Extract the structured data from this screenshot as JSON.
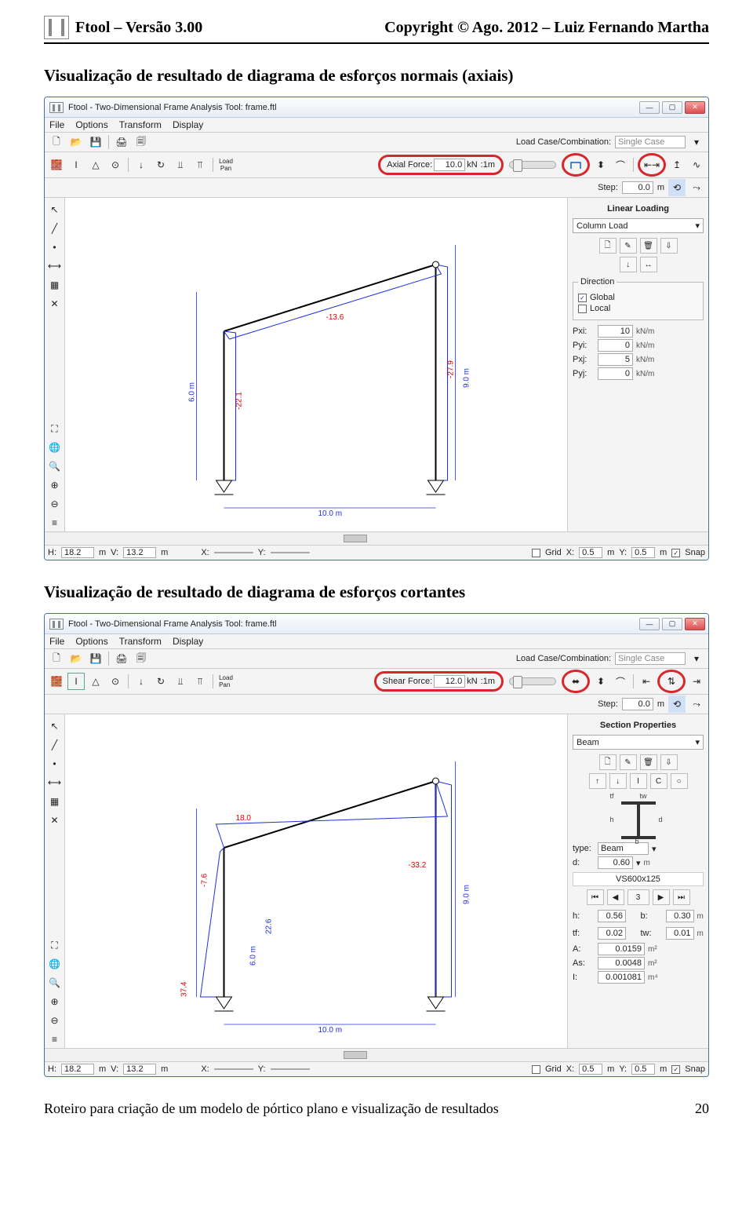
{
  "doc": {
    "header_left": "Ftool – Versão 3.00",
    "header_right": "Copyright © Ago. 2012 – Luiz Fernando Martha",
    "sec1": "Visualização de resultado de diagrama de esforços normais (axiais)",
    "sec2": "Visualização de resultado de diagrama de esforços cortantes",
    "footer_left": "Roteiro para criação de um modelo de pórtico plano e visualização de resultados",
    "footer_right": "20"
  },
  "app": {
    "title": "Ftool - Two-Dimensional Frame Analysis Tool: frame.ftl",
    "menu": [
      "File",
      "Options",
      "Transform",
      "Display"
    ],
    "load_combo_label": "Load Case/Combination:",
    "load_combo_value": "Single Case",
    "step_label": "Step:",
    "step_value": "0.0",
    "step_unit": "m",
    "load_lbl": "Load\nPan"
  },
  "win1": {
    "force_label": "Axial Force:",
    "force_value": "10.0",
    "force_unit": "kN",
    "force_unit2": ":1m",
    "panel_title": "Linear Loading",
    "panel_drop": "Column Load",
    "direction_title": "Direction",
    "dir_global": "Global",
    "dir_local": "Local",
    "params": [
      {
        "l": "Pxi:",
        "v": "10",
        "u": "kN/m"
      },
      {
        "l": "Pyi:",
        "v": "0",
        "u": "kN/m"
      },
      {
        "l": "Pxj:",
        "v": "5",
        "u": "kN/m"
      },
      {
        "l": "Pyj:",
        "v": "0",
        "u": "kN/m"
      }
    ],
    "canvas_labels": {
      "top_dia": "-13.6",
      "left_col": "-22.1",
      "right_col": "-27.9",
      "left_h": "6.0 m",
      "right_h": "9.0 m",
      "span": "10.0 m"
    }
  },
  "win2": {
    "force_label": "Shear Force:",
    "force_value": "12.0",
    "force_unit": "kN",
    "force_unit2": ":1m",
    "panel_title": "Section Properties",
    "panel_drop": "Beam",
    "type_label": "type:",
    "type_value": "Beam",
    "d_label": "d:",
    "d_value": "0.60",
    "d_unit": "m",
    "shape": "VS600x125",
    "nav_count": "3",
    "props": [
      {
        "l": "h:",
        "v": "0.56"
      },
      {
        "l": "b:",
        "v": "0.30"
      },
      {
        "l": "tf:",
        "v": "0.02"
      },
      {
        "l": "tw:",
        "v": "0.01"
      }
    ],
    "props_u": "m",
    "derived": [
      {
        "l": "A:",
        "v": "0.0159",
        "u": "m²"
      },
      {
        "l": "As:",
        "v": "0.0048",
        "u": "m²"
      },
      {
        "l": "I:",
        "v": "0.001081",
        "u": "m⁴"
      }
    ],
    "ibeam_dims": {
      "tw": "tw",
      "tf": "tf",
      "h": "h",
      "d": "d",
      "b": "b"
    },
    "canvas_labels": {
      "dia_left": "18.0",
      "dia_right": "-33.2",
      "left_col_top": "-7.6",
      "left_col_bot": "37.4",
      "left_dim": "22.6",
      "left_h": "6.0 m",
      "right_h": "9.0 m",
      "span": "10.0 m"
    }
  },
  "status": {
    "H": "H:",
    "Hv": "18.2",
    "Hu": "m",
    "V": "V:",
    "Vv": "13.2",
    "Vu": "m",
    "X": "X:",
    "Y": "Y:",
    "Grid": "Grid",
    "GX": "X:",
    "GXv": "0.5",
    "GXu": "m",
    "GY": "Y:",
    "GYv": "0.5",
    "GYu": "m",
    "Snap": "Snap"
  }
}
